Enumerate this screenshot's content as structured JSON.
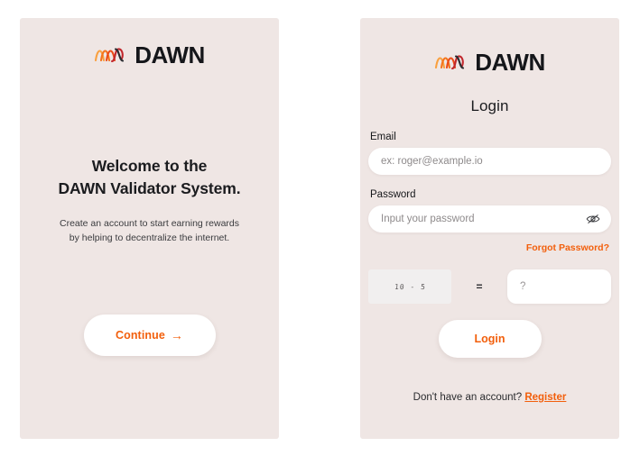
{
  "brand": {
    "name": "DAWN",
    "mark_icon": "dawn-wave-icon",
    "accent_color": "#F25F0C",
    "panel_background": "#EFE6E4",
    "page_background": "#FFFFFF"
  },
  "left_panel": {
    "welcome_line1": "Welcome to the",
    "welcome_line2": "DAWN Validator System.",
    "subtitle": "Create an account to start earning rewards by helping to decentralize the internet.",
    "continue_label": "Continue",
    "continue_arrow": "→"
  },
  "right_panel": {
    "heading": "Login",
    "email": {
      "label": "Email",
      "placeholder": "ex: roger@example.io",
      "value": ""
    },
    "password": {
      "label": "Password",
      "placeholder": "Input your password",
      "value": "",
      "toggle_icon": "eye-off-icon"
    },
    "forgot_password_label": "Forgot Password?",
    "captcha": {
      "challenge": "10 - 5",
      "equals": "=",
      "answer_placeholder": "?",
      "answer_value": ""
    },
    "login_label": "Login",
    "register_prompt": "Don't have an account?",
    "register_label": "Register"
  }
}
